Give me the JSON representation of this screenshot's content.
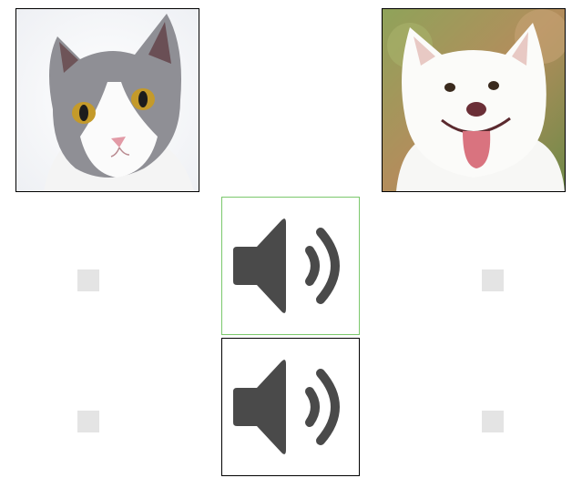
{
  "images": {
    "cat": {
      "icon": "cat-photo",
      "subject": "cat"
    },
    "dog": {
      "icon": "dog-photo",
      "subject": "dog"
    }
  },
  "sound_buttons": [
    {
      "icon": "speaker-icon",
      "state": "selected",
      "border_color": "#7bc86c"
    },
    {
      "icon": "speaker-icon",
      "state": "default",
      "border_color": "#000000"
    }
  ],
  "answer_slots": {
    "row1": [
      "empty",
      "empty"
    ],
    "row2": [
      "empty",
      "empty"
    ]
  },
  "colors": {
    "speaker": "#4a4a4a",
    "slot": "#e4e4e4",
    "selected_border": "#7bc86c"
  }
}
